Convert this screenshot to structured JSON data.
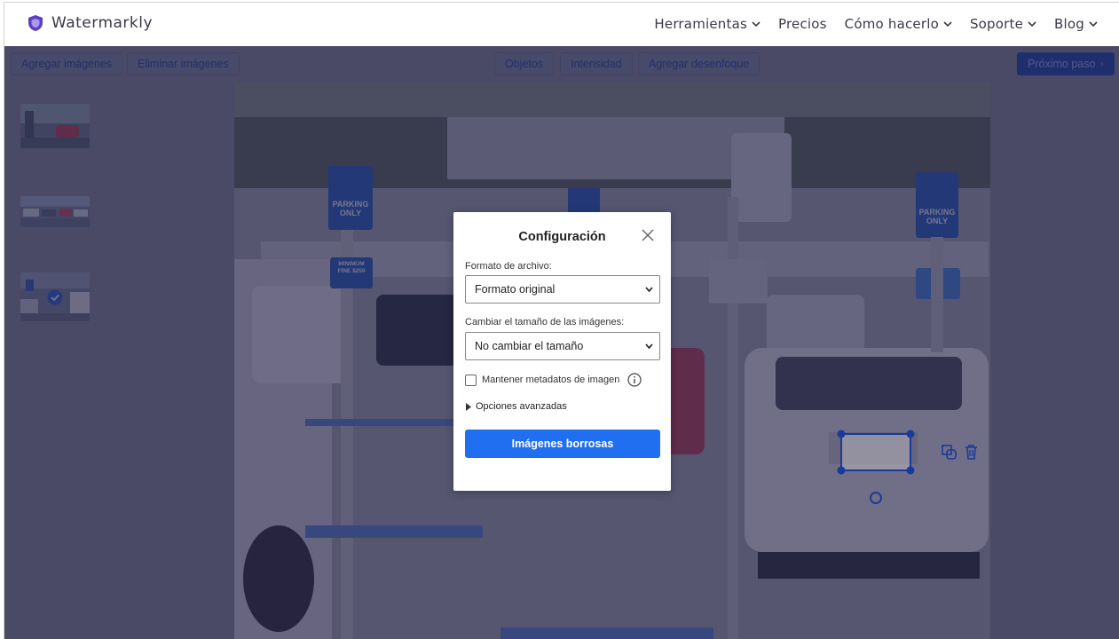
{
  "header": {
    "brand_name": "Watermarkly",
    "nav": [
      {
        "label": "Herramientas",
        "dropdown": true
      },
      {
        "label": "Precios",
        "dropdown": false
      },
      {
        "label": "Cómo hacerlo",
        "dropdown": true
      },
      {
        "label": "Soporte",
        "dropdown": true
      },
      {
        "label": "Blog",
        "dropdown": true
      }
    ]
  },
  "toolbar": {
    "add_images": "Agregar imágenes",
    "remove_images": "Eliminar imágenes",
    "objects": "Objetos",
    "intensity": "Intensidad",
    "add_blur": "Agregar desenfoque",
    "next_step": "Próximo paso"
  },
  "photo_signs": {
    "parking_only_1": "PARKING ONLY",
    "parking_only_2": "PARKING ONLY",
    "fine_sign": "MINIMUM FINE $250"
  },
  "modal": {
    "title": "Configuración",
    "file_format_label": "Formato de archivo:",
    "file_format_value": "Formato original",
    "resize_label": "Cambiar el tamaño de las imágenes:",
    "resize_value": "No cambiar el tamaño",
    "keep_metadata_label": "Mantener metadatos de imagen",
    "keep_metadata_checked": false,
    "advanced_options": "Opciones avanzadas",
    "blur_button": "Imágenes borrosas"
  },
  "colors": {
    "brand_shield": "#5b3fc4",
    "primary_button": "#1f6ff0",
    "next_button": "#1a48a8"
  }
}
